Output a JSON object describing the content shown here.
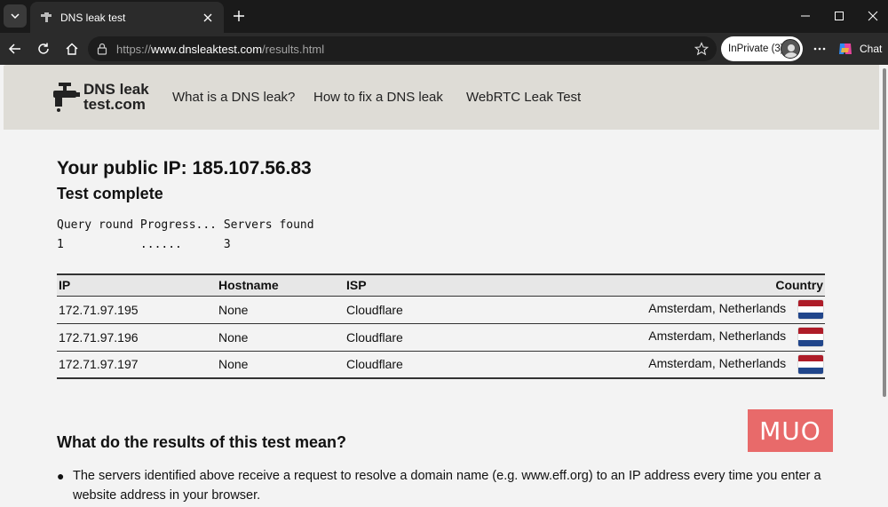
{
  "browser": {
    "tab_title": "DNS leak test",
    "url_scheme": "https://",
    "url_host": "www.dnsleaktest.com",
    "url_path": "/results.html",
    "inprivate_label": "InPrivate (3)",
    "chat_label": "Chat"
  },
  "site": {
    "logo_line1": "DNS leak",
    "logo_line2": "test.com",
    "nav": [
      "What is a DNS leak?",
      "How to fix a DNS leak",
      "WebRTC Leak Test"
    ]
  },
  "result": {
    "public_ip_heading": "Your public IP: 185.107.56.83",
    "status": "Test complete",
    "progress_header": "Query round Progress... Servers found",
    "progress_row": "1           ......      3"
  },
  "table": {
    "headers": [
      "IP",
      "Hostname",
      "ISP",
      "Country"
    ],
    "rows": [
      {
        "ip": "172.71.97.195",
        "hostname": "None",
        "isp": "Cloudflare",
        "country": "Amsterdam, Netherlands"
      },
      {
        "ip": "172.71.97.196",
        "hostname": "None",
        "isp": "Cloudflare",
        "country": "Amsterdam, Netherlands"
      },
      {
        "ip": "172.71.97.197",
        "hostname": "None",
        "isp": "Cloudflare",
        "country": "Amsterdam, Netherlands"
      }
    ],
    "flag_colors": [
      "#ae1c28",
      "#ffffff",
      "#21468b"
    ]
  },
  "meaning": {
    "heading": "What do the results of this test mean?",
    "bullet": "The servers identified above receive a request to resolve a domain name (e.g. www.eff.org) to an IP address every time you enter a website address in your browser."
  },
  "watermark": "MUO",
  "colors": {
    "header_bg": "#dedcd6",
    "page_bg": "#f3f3f3",
    "watermark_bg": "#e86a6a"
  }
}
